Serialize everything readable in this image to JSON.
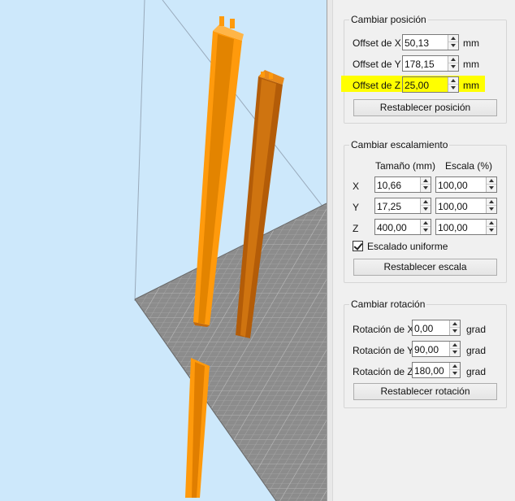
{
  "position": {
    "title": "Cambiar posición",
    "unit": "mm",
    "offset_x": {
      "label": "Offset de X",
      "value": "50,13"
    },
    "offset_y": {
      "label": "Offset de Y",
      "value": "178,15"
    },
    "offset_z": {
      "label": "Offset de Z",
      "value": "25,00",
      "highlight_color": "#ffff00"
    },
    "reset_label": "Restablecer posición"
  },
  "scale": {
    "title": "Cambiar escalamiento",
    "size_header": "Tamaño (mm)",
    "scale_header": "Escala (%)",
    "rows": [
      {
        "axis": "X",
        "size": "10,66",
        "scale": "100,00"
      },
      {
        "axis": "Y",
        "size": "17,25",
        "scale": "100,00"
      },
      {
        "axis": "Z",
        "size": "400,00",
        "scale": "100,00"
      }
    ],
    "uniform_label": "Escalado uniforme",
    "uniform_checked": true,
    "reset_label": "Restablecer escala"
  },
  "rotation": {
    "title": "Cambiar rotación",
    "unit": "grad",
    "rot_x": {
      "label": "Rotación de X",
      "value": "0,00"
    },
    "rot_y": {
      "label": "Rotación de Y",
      "value": "90,00"
    },
    "rot_z": {
      "label": "Rotación de Z",
      "value": "180,00"
    },
    "reset_label": "Restablecer rotación"
  },
  "viewport": {
    "background_color": "#cde8fb",
    "bed_color": "#8a8a8a",
    "selected_model_color": "#ff9a0c",
    "other_model_color": "#c46a0c"
  }
}
